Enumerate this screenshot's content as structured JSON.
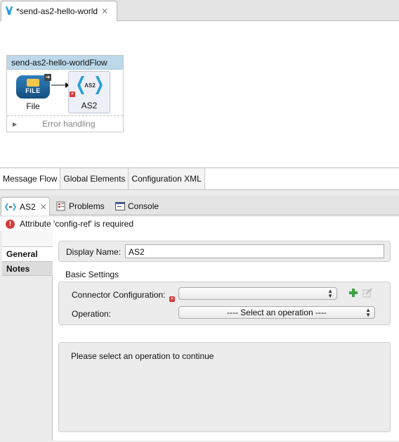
{
  "editor": {
    "tab_title": "*send-as2-hello-world",
    "close_glyph": "✕",
    "flow": {
      "name": "send-as2-hello-worldFlow",
      "file_node": {
        "icon_text": "FILE",
        "label": "File"
      },
      "as2_node": {
        "icon_text": "AS2",
        "label": "AS2"
      },
      "error_handling_label": "Error handling"
    },
    "bottom_tabs": [
      "Message Flow",
      "Global Elements",
      "Configuration XML"
    ]
  },
  "properties": {
    "tabs": {
      "as2": "AS2",
      "problems": "Problems",
      "console": "Console"
    },
    "error_message": "Attribute 'config-ref' is required",
    "side_tabs": {
      "general": "General",
      "notes": "Notes"
    },
    "display_name": {
      "label": "Display Name:",
      "value": "AS2"
    },
    "basic_settings": {
      "title": "Basic Settings",
      "connector_configuration_label": "Connector Configuration:",
      "connector_configuration_value": "",
      "operation_label": "Operation:",
      "operation_value": "---- Select an operation ----"
    },
    "info_message": "Please select an operation to continue"
  },
  "colors": {
    "flow_header": "#bcd8ea",
    "error_red": "#d43a3a",
    "as2_icon_blue": "#2a9fd6",
    "file_icon_blue": "#1f639a"
  }
}
